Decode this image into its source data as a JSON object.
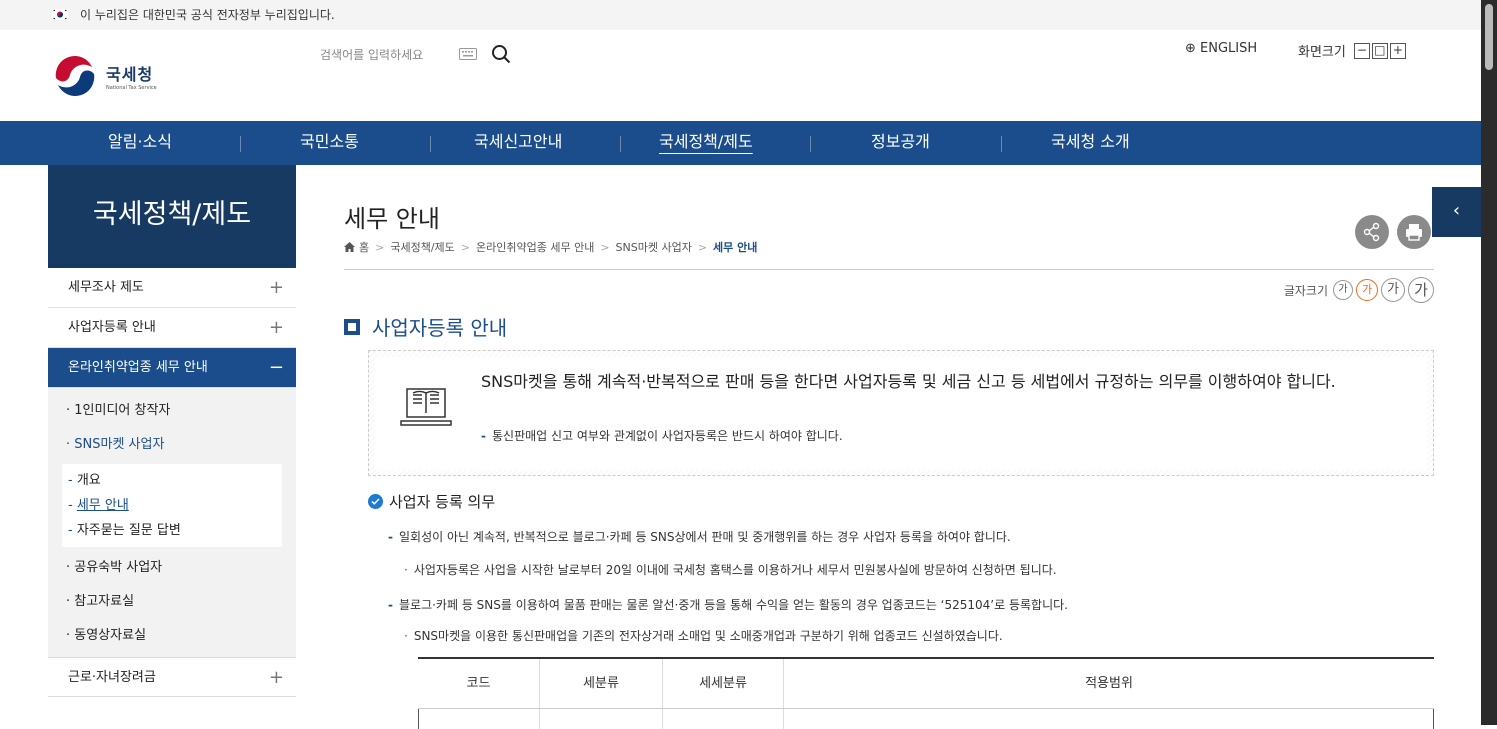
{
  "topbar": {
    "text": "이 누리집은 대한민국 공식 전자정부 누리집입니다."
  },
  "header": {
    "logo_ko": "국세청",
    "logo_en": "National Tax Service",
    "search_placeholder": "검색어를 입력하세요",
    "english": "⊕ ENGLISH",
    "zoom_label": "화면크기",
    "zoom_minus": "−",
    "zoom_reset": "□",
    "zoom_plus": "+"
  },
  "gnb": [
    "알림·소식",
    "국민소통",
    "국세신고안내",
    "국세정책/제도",
    "정보공개",
    "국세청 소개"
  ],
  "sidebar": {
    "title": "국세정책/제도",
    "items": [
      {
        "label": "세무조사 제도",
        "pm": "+"
      },
      {
        "label": "사업자등록 안내",
        "pm": "+"
      },
      {
        "label": "온라인취약업종 세무 안내",
        "pm": "−"
      }
    ],
    "sub": [
      "1인미디어 창작자",
      "SNS마켓 사업자"
    ],
    "subsub": [
      "개요",
      "세무 안내",
      "자주묻는 질문 답변"
    ],
    "sub2": [
      "공유숙박 사업자",
      "참고자료실",
      "동영상자료실"
    ],
    "items2": [
      {
        "label": "근로·자녀장려금",
        "pm": "+"
      }
    ]
  },
  "content": {
    "title": "세무 안내",
    "breadcrumb": [
      "홈",
      "국세정책/제도",
      "온라인취약업종 세무 안내",
      "SNS마켓 사업자",
      "세무 안내"
    ],
    "fontsize_label": "글자크기",
    "fontsize_glyph": "가",
    "section_title": "사업자등록 안내",
    "info_text": "SNS마켓을 통해 계속적·반복적으로 판매 등을 한다면 사업자등록 및 세금 신고 등 세법에서 규정하는 의무를 이행하여야 합니다.",
    "info_note": "통신판매업 신고 여부와 관계없이 사업자등록은 반드시 하여야 합니다.",
    "duty_title": "사업자 등록 의무",
    "bullet1": "일회성이 아닌 계속적, 반복적으로 블로그·카페 등 SNS상에서 판매 및 중개행위를 하는 경우 사업자 등록을 하여야 합니다.",
    "bullet1_sub": "사업자등록은 사업을 시작한 날로부터 20일 이내에 국세청 홈택스를 이용하거나 세무서 민원봉사실에 방문하여 신청하면 됩니다.",
    "bullet2": "블로그·카페 등 SNS를 이용하여 물품 판매는 물론 알선·중개 등을 통해 수익을 얻는 활동의 경우 업종코드는 ‘525104’로 등록합니다.",
    "bullet2_sub": "SNS마켓을 이용한 통신판매업을 기존의 전자상거래 소매업 및 소매중개업과 구분하기 위해 업종코드 신설하였습니다.",
    "table_headers": [
      "코드",
      "세분류",
      "세세분류",
      "적용범위"
    ]
  }
}
